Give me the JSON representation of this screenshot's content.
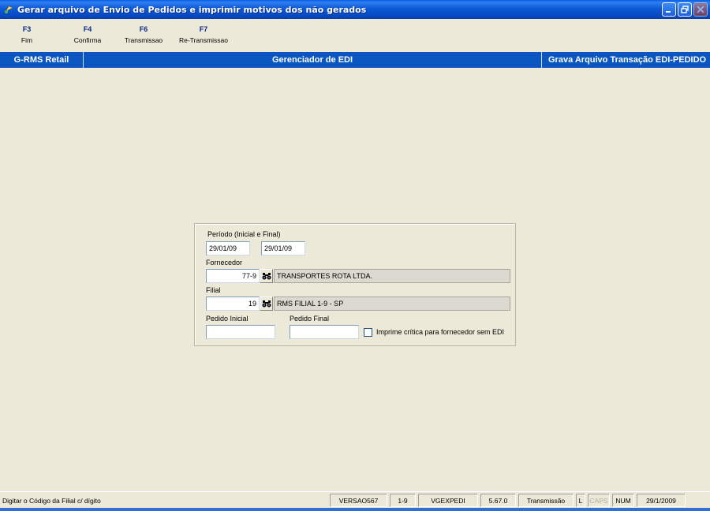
{
  "window": {
    "title": "Gerar arquivo de Envio de Pedidos e imprimir motivos dos não gerados",
    "app_icon": "gear-icon",
    "controls": [
      "minimize-icon",
      "restore-icon",
      "close-icon"
    ]
  },
  "toolbar": {
    "fkeys": [
      {
        "key": "F3",
        "label": "Fim"
      },
      {
        "key": "F4",
        "label": "Confirma"
      },
      {
        "key": "F6",
        "label": "Transmissao"
      },
      {
        "key": "F7",
        "label": "Re-Transmissao"
      }
    ]
  },
  "header": {
    "left": "G-RMS Retail",
    "center": "Gerenciador de EDI",
    "right": "Grava Arquivo Transação EDI-PEDIDO"
  },
  "form": {
    "periodo_label": "Período (Inicial e Final)",
    "data_inicial": "29/01/09",
    "data_final": "29/01/09",
    "fornecedor_label": "Fornecedor",
    "fornecedor_codigo": "77-9",
    "fornecedor_nome": "TRANSPORTES ROTA LTDA.",
    "filial_label": "Filial",
    "filial_codigo": "19",
    "filial_nome": "RMS FILIAL 1-9 - SP",
    "pedido_inicial_label": "Pedido Inicial",
    "pedido_inicial": "",
    "pedido_final_label": "Pedido Final",
    "pedido_final": "",
    "imprime_label": "Imprime crítica para fornecedor sem EDI",
    "imprime_checked": false,
    "search_icon": "binoculars-icon"
  },
  "status": {
    "message": "Digitar o Código da Filial c/ dígito",
    "versao": "VERSAO567",
    "empresa": "1-9",
    "programa": "VGEXPEDI",
    "release": "5.67.0",
    "modo": "Transmissão",
    "l": "L",
    "caps": "CAPS",
    "num": "NUM",
    "date": "29/1/2009"
  },
  "colors": {
    "titlebar": "#0a5fe0",
    "module_bar": "#0a55c0",
    "fkey_text": "#0a2a8c",
    "background": "#ece9d8"
  }
}
